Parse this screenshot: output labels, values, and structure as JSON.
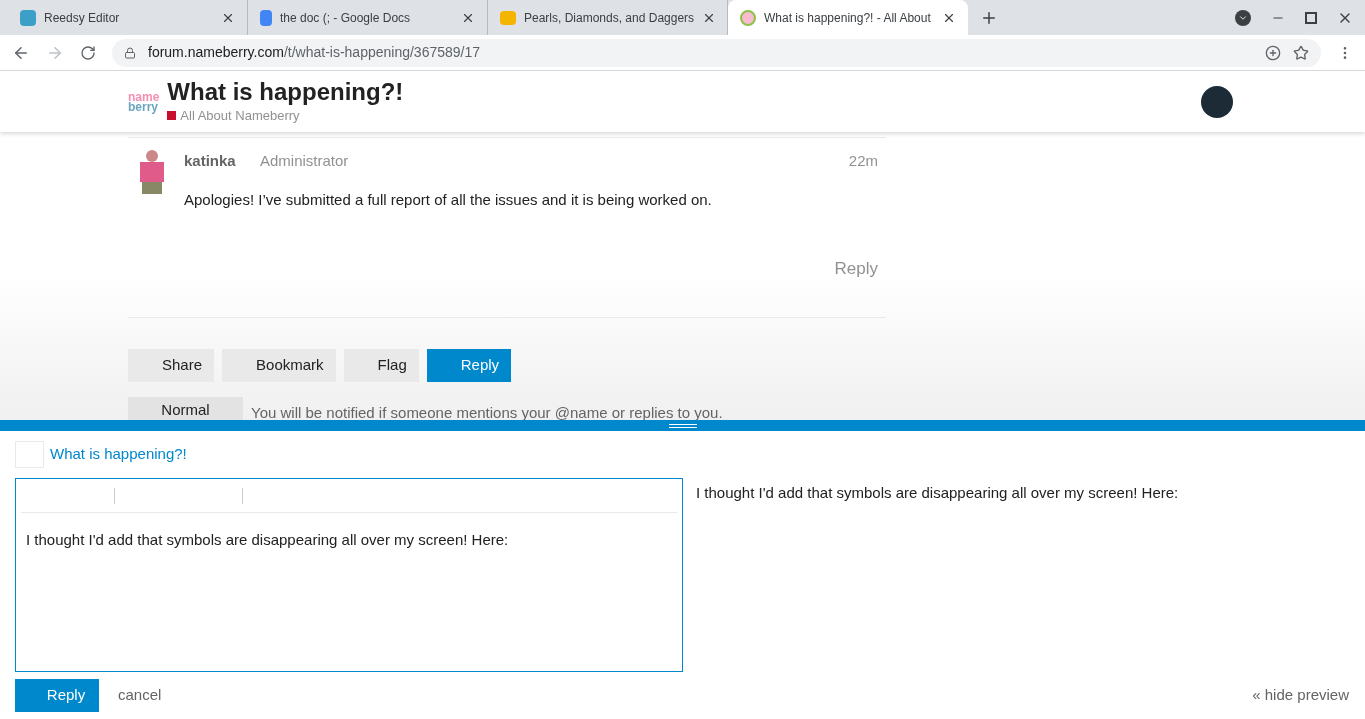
{
  "browser": {
    "tabs": [
      {
        "title": "Reedsy Editor",
        "selected": false
      },
      {
        "title": "the doc (; - Google Docs",
        "selected": false
      },
      {
        "title": "Pearls, Diamonds, and Daggers",
        "selected": false
      },
      {
        "title": "What is happening?! - All About",
        "selected": true
      }
    ],
    "url_host": "forum.nameberry.com",
    "url_path": "/t/what-is-happening/367589/17"
  },
  "header": {
    "logo_top": "name",
    "logo_bottom": "berry",
    "title": "What is happening?!",
    "category": "All About Nameberry"
  },
  "post": {
    "username": "katinka",
    "role": "Administrator",
    "time": "22m",
    "body": "Apologies! I’ve submitted a full report of all the issues and it is being worked on.",
    "reply": "Reply"
  },
  "actions": [
    {
      "label": "Share",
      "primary": false
    },
    {
      "label": "Bookmark",
      "primary": false
    },
    {
      "label": "Flag",
      "primary": false
    },
    {
      "label": "Reply",
      "primary": true
    }
  ],
  "notification": {
    "level": "Normal",
    "text": "You will be notified if someone mentions your @name or replies to you."
  },
  "composer": {
    "title": "What is happening?!",
    "text": "I thought I'd add that symbols are disappearing all over my screen! Here:",
    "preview": "I thought I'd add that symbols are disappearing all over my screen! Here:",
    "submit": "Reply",
    "cancel": "cancel",
    "hide_preview": "« hide preview"
  }
}
